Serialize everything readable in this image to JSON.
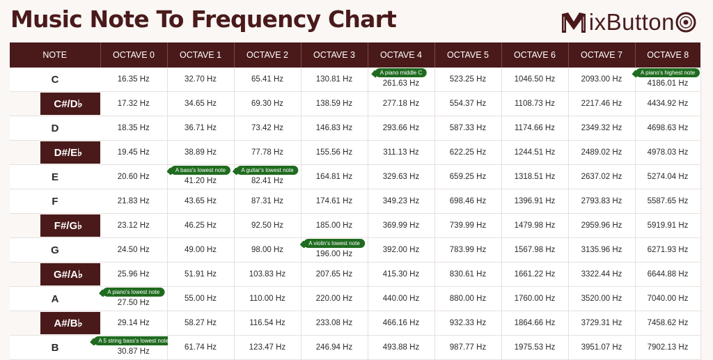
{
  "title": "Music Note To Frequency Chart",
  "logo": {
    "text": "ixButton"
  },
  "headers": [
    "NOTE",
    "OCTAVE 0",
    "OCTAVE 1",
    "OCTAVE 2",
    "OCTAVE 3",
    "OCTAVE 4",
    "OCTAVE 5",
    "OCTAVE 6",
    "OCTAVE 7",
    "OCTAVE 8"
  ],
  "rows": [
    {
      "note": "C",
      "sharp": false,
      "values": [
        "16.35 Hz",
        "32.70 Hz",
        "65.41 Hz",
        "130.81 Hz",
        "261.63 Hz",
        "523.25 Hz",
        "1046.50 Hz",
        "2093.00 Hz",
        "4186.01 Hz"
      ]
    },
    {
      "note": "C#/D♭",
      "sharp": true,
      "values": [
        "17.32 Hz",
        "34.65 Hz",
        "69.30 Hz",
        "138.59 Hz",
        "277.18 Hz",
        "554.37 Hz",
        "1108.73 Hz",
        "2217.46 Hz",
        "4434.92 Hz"
      ]
    },
    {
      "note": "D",
      "sharp": false,
      "values": [
        "18.35 Hz",
        "36.71 Hz",
        "73.42 Hz",
        "146.83 Hz",
        "293.66 Hz",
        "587.33 Hz",
        "1174.66 Hz",
        "2349.32 Hz",
        "4698.63 Hz"
      ]
    },
    {
      "note": "D#/E♭",
      "sharp": true,
      "values": [
        "19.45 Hz",
        "38.89 Hz",
        "77.78 Hz",
        "155.56 Hz",
        "311.13 Hz",
        "622.25 Hz",
        "1244.51 Hz",
        "2489.02 Hz",
        "4978.03 Hz"
      ]
    },
    {
      "note": "E",
      "sharp": false,
      "values": [
        "20.60 Hz",
        "41.20 Hz",
        "82.41 Hz",
        "164.81 Hz",
        "329.63 Hz",
        "659.25 Hz",
        "1318.51 Hz",
        "2637.02 Hz",
        "5274.04 Hz"
      ]
    },
    {
      "note": "F",
      "sharp": false,
      "values": [
        "21.83 Hz",
        "43.65 Hz",
        "87.31 Hz",
        "174.61 Hz",
        "349.23 Hz",
        "698.46 Hz",
        "1396.91 Hz",
        "2793.83 Hz",
        "5587.65 Hz"
      ]
    },
    {
      "note": "F#/G♭",
      "sharp": true,
      "values": [
        "23.12 Hz",
        "46.25 Hz",
        "92.50 Hz",
        "185.00 Hz",
        "369.99 Hz",
        "739.99 Hz",
        "1479.98 Hz",
        "2959.96 Hz",
        "5919.91 Hz"
      ]
    },
    {
      "note": "G",
      "sharp": false,
      "values": [
        "24.50 Hz",
        "49.00 Hz",
        "98.00 Hz",
        "196.00 Hz",
        "392.00 Hz",
        "783.99 Hz",
        "1567.98 Hz",
        "3135.96 Hz",
        "6271.93 Hz"
      ]
    },
    {
      "note": "G#/A♭",
      "sharp": true,
      "values": [
        "25.96 Hz",
        "51.91 Hz",
        "103.83 Hz",
        "207.65 Hz",
        "415.30 Hz",
        "830.61 Hz",
        "1661.22 Hz",
        "3322.44 Hz",
        "6644.88 Hz"
      ]
    },
    {
      "note": "A",
      "sharp": false,
      "values": [
        "27.50 Hz",
        "55.00 Hz",
        "110.00 Hz",
        "220.00 Hz",
        "440.00 Hz",
        "880.00 Hz",
        "1760.00 Hz",
        "3520.00 Hz",
        "7040.00 Hz"
      ]
    },
    {
      "note": "A#/B♭",
      "sharp": true,
      "values": [
        "29.14 Hz",
        "58.27 Hz",
        "116.54 Hz",
        "233.08 Hz",
        "466.16 Hz",
        "932.33 Hz",
        "1864.66 Hz",
        "3729.31 Hz",
        "7458.62 Hz"
      ]
    },
    {
      "note": "B",
      "sharp": false,
      "values": [
        "30.87 Hz",
        "61.74 Hz",
        "123.47 Hz",
        "246.94 Hz",
        "493.88 Hz",
        "987.77 Hz",
        "1975.53 Hz",
        "3951.07 Hz",
        "7902.13 Hz"
      ]
    }
  ],
  "annotations": [
    {
      "row": 0,
      "col": 4,
      "text": "A piano middle C"
    },
    {
      "row": 0,
      "col": 8,
      "text": "A piano's highest note"
    },
    {
      "row": 4,
      "col": 1,
      "text": "A bass's lowest note"
    },
    {
      "row": 4,
      "col": 2,
      "text": "A guitar's lowest note"
    },
    {
      "row": 7,
      "col": 3,
      "text": "A violin's lowest note"
    },
    {
      "row": 9,
      "col": 0,
      "text": "A piano's lowest note"
    },
    {
      "row": 11,
      "col": 0,
      "text": "A 5 string bass's lowest note"
    }
  ],
  "colors": {
    "brand": "#4a1a1b",
    "annotation": "#1f6b1f",
    "background": "#faf7f5"
  }
}
